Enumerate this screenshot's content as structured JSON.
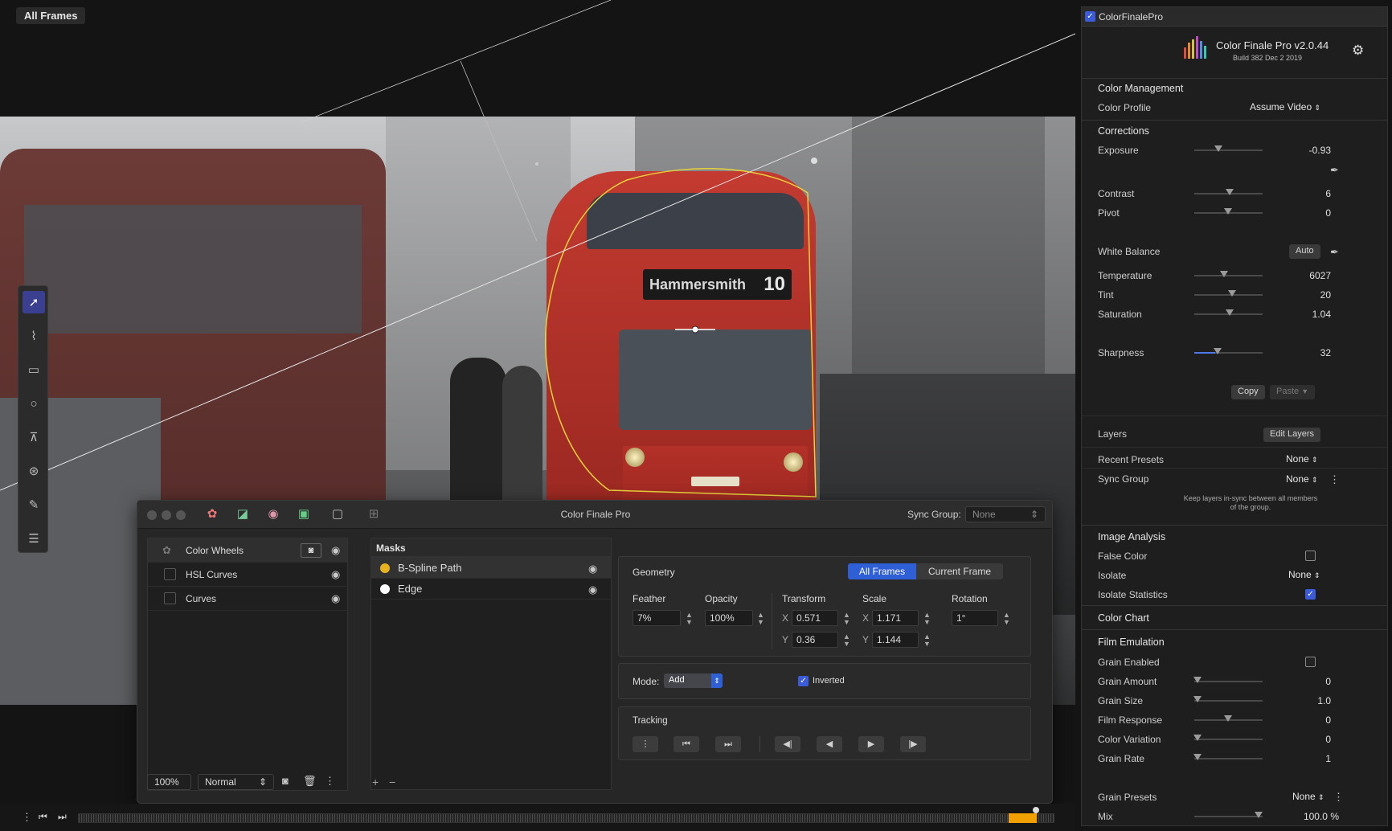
{
  "viewer": {
    "frame_mode": "All Frames",
    "bus_sign": "Hammersmith",
    "bus_number": "10"
  },
  "panel": {
    "title": "Color Finale Pro",
    "sync_group_label": "Sync Group:",
    "sync_group_value": "None",
    "layers": [
      {
        "label": "Color Wheels"
      },
      {
        "label": "HSL Curves"
      },
      {
        "label": "Curves"
      }
    ],
    "zoom": "100%",
    "blend_mode": "Normal",
    "masks_header": "Masks",
    "masks": [
      {
        "label": "B-Spline Path",
        "color": "#e8b21f"
      },
      {
        "label": "Edge",
        "color": "#ffffff"
      }
    ],
    "geometry": {
      "title": "Geometry",
      "tab_all": "All Frames",
      "tab_current": "Current Frame",
      "feather_label": "Feather",
      "feather": "7%",
      "opacity_label": "Opacity",
      "opacity": "100%",
      "transform_label": "Transform",
      "tx": "0.571",
      "ty": "0.36",
      "scale_label": "Scale",
      "sx": "1.171",
      "sy": "1.144",
      "rotation_label": "Rotation",
      "rotation": "1°",
      "x": "X",
      "y": "Y"
    },
    "mode_label": "Mode:",
    "mode_value": "Add",
    "inverted_label": "Inverted",
    "tracking_label": "Tracking"
  },
  "inspector": {
    "plugin_name": "ColorFinalePro",
    "product": "Color Finale Pro v2.0.44",
    "build": "Build 382 Dec  2 2019",
    "color_management": "Color Management",
    "color_profile_label": "Color Profile",
    "color_profile": "Assume Video",
    "corrections": "Corrections",
    "exposure_label": "Exposure",
    "exposure": "-0.93",
    "contrast_label": "Contrast",
    "contrast": "6",
    "pivot_label": "Pivot",
    "pivot": "0",
    "white_balance_label": "White Balance",
    "auto": "Auto",
    "temperature_label": "Temperature",
    "temperature": "6027",
    "tint_label": "Tint",
    "tint": "20",
    "saturation_label": "Saturation",
    "saturation": "1.04",
    "sharpness_label": "Sharpness",
    "sharpness": "32",
    "copy": "Copy",
    "paste": "Paste",
    "layers_label": "Layers",
    "edit_layers": "Edit Layers",
    "recent_presets_label": "Recent Presets",
    "recent_presets": "None",
    "sync_group_label": "Sync Group",
    "sync_group": "None",
    "sync_note_1": "Keep layers in-sync between all members",
    "sync_note_2": "of the group.",
    "image_analysis": "Image Analysis",
    "false_color_label": "False Color",
    "isolate_label": "Isolate",
    "isolate": "None",
    "isolate_stats_label": "Isolate Statistics",
    "color_chart": "Color Chart",
    "film_emulation": "Film Emulation",
    "grain_enabled_label": "Grain Enabled",
    "grain_amount_label": "Grain Amount",
    "grain_amount": "0",
    "grain_size_label": "Grain Size",
    "grain_size": "1.0",
    "film_response_label": "Film Response",
    "film_response": "0",
    "color_variation_label": "Color Variation",
    "color_variation": "0",
    "grain_rate_label": "Grain Rate",
    "grain_rate": "1",
    "grain_presets_label": "Grain Presets",
    "grain_presets": "None",
    "mix_label": "Mix",
    "mix": "100.0 %"
  },
  "colors": {
    "accent": "#3b5bd9",
    "mask_path": "#e8d23a",
    "playhead": "#f0a000"
  }
}
